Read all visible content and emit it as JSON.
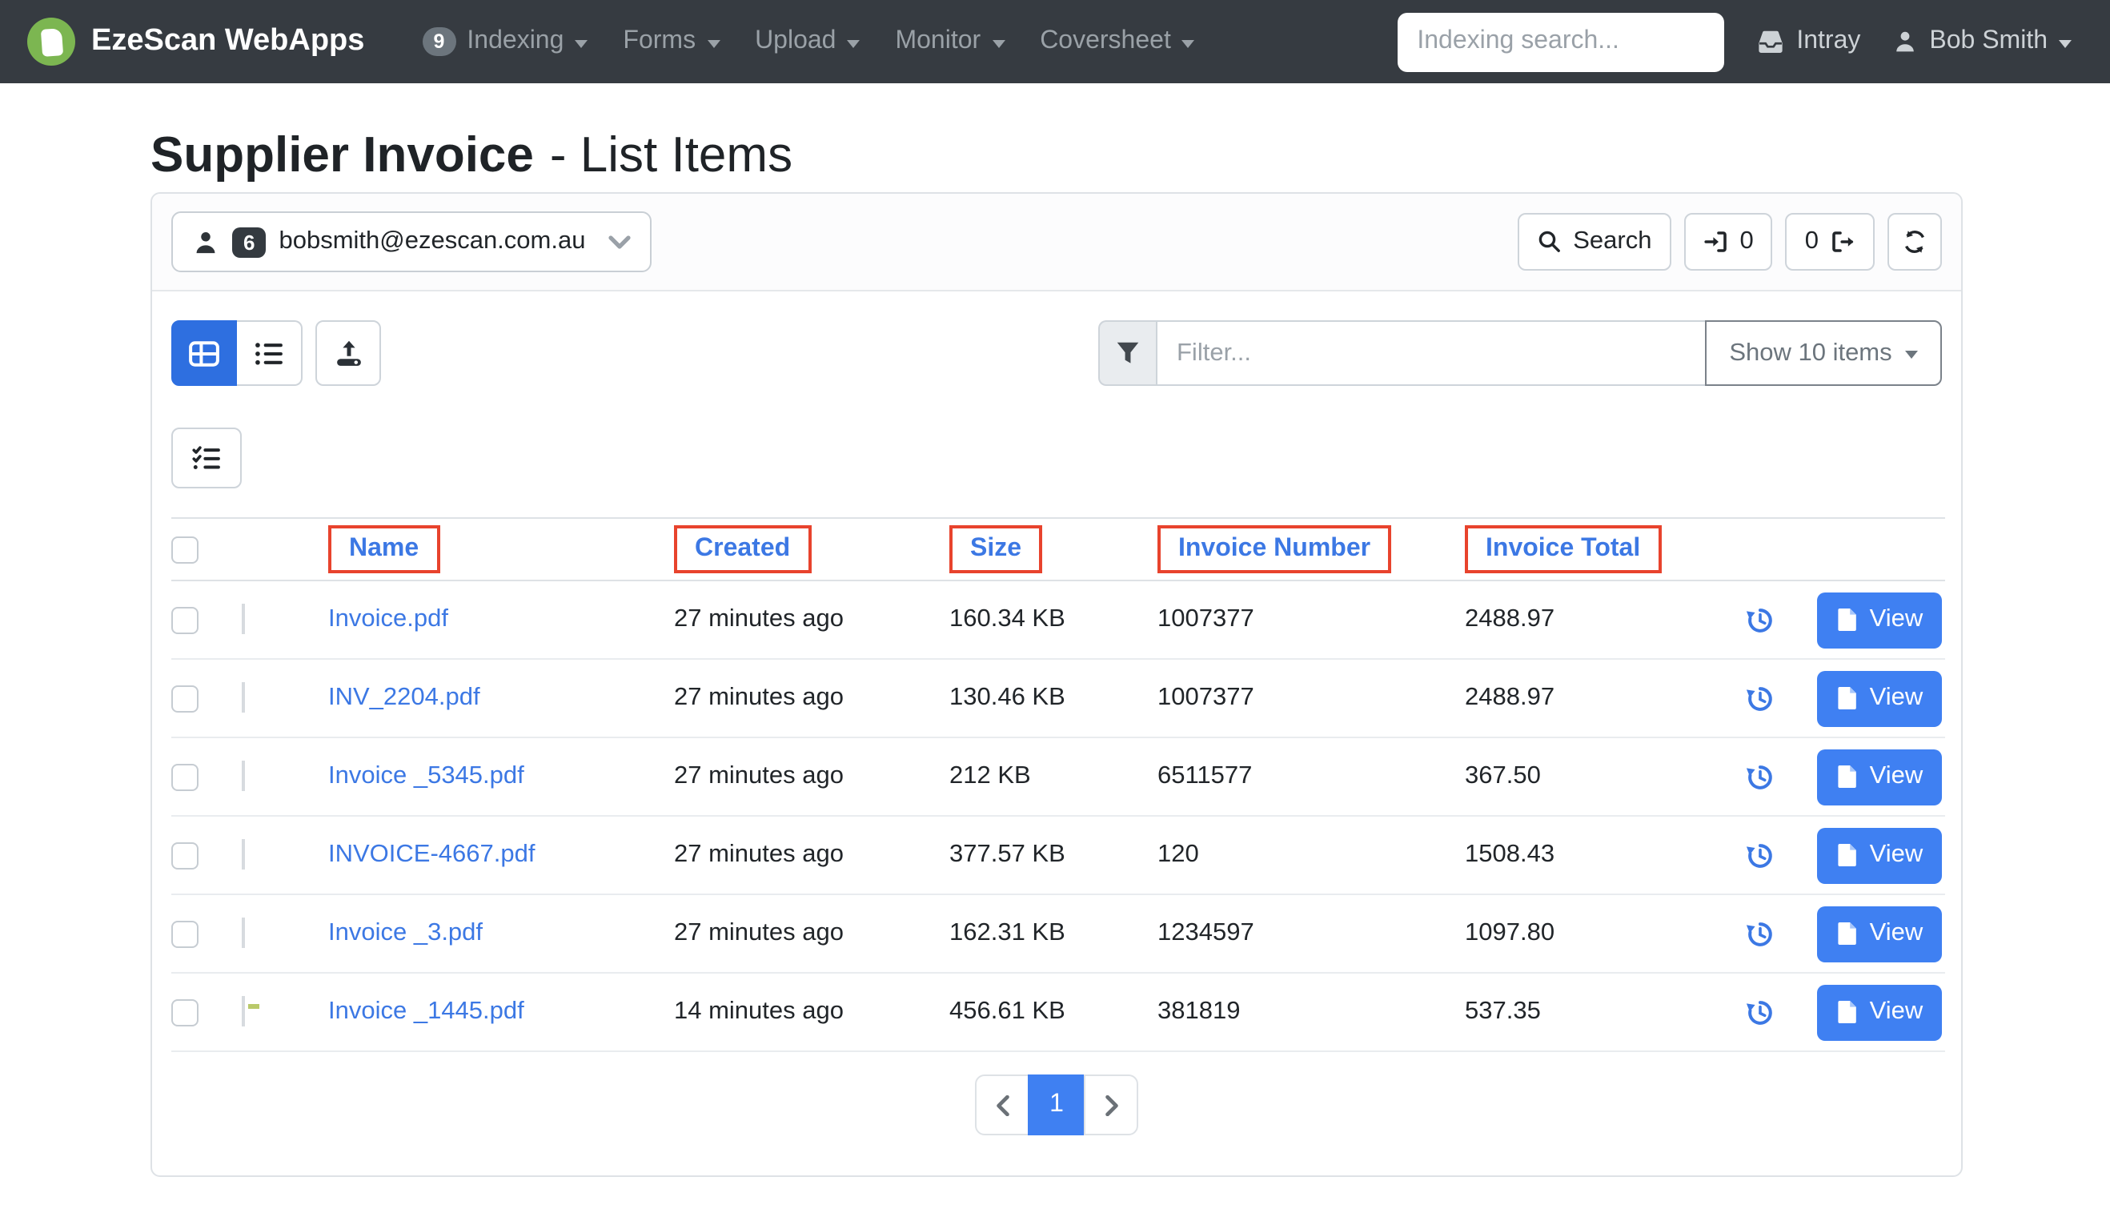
{
  "navbar": {
    "brand": "EzeScan WebApps",
    "indexing_badge": "9",
    "items": [
      {
        "label": "Indexing"
      },
      {
        "label": "Forms"
      },
      {
        "label": "Upload"
      },
      {
        "label": "Monitor"
      },
      {
        "label": "Coversheet"
      }
    ],
    "search_placeholder": "Indexing search...",
    "intray_label": "Intray",
    "user_label": "Bob Smith"
  },
  "page": {
    "title": "Supplier Invoice",
    "subtitle": "- List Items"
  },
  "queue_bar": {
    "user_badge": "6",
    "user_email": "bobsmith@ezescan.com.au",
    "search_label": "Search",
    "checkin_count": "0",
    "checkout_count": "0"
  },
  "toolbar": {
    "filter_placeholder": "Filter...",
    "show_items_label": "Show 10 items"
  },
  "table": {
    "columns": [
      {
        "label": "Name"
      },
      {
        "label": "Created"
      },
      {
        "label": "Size"
      },
      {
        "label": "Invoice Number"
      },
      {
        "label": "Invoice Total"
      }
    ],
    "view_button_label": "View",
    "rows": [
      {
        "name": "Invoice.pdf",
        "created": "27 minutes ago",
        "size": "160.34 KB",
        "invoice_number": "1007377",
        "invoice_total": "2488.97"
      },
      {
        "name": "INV_2204.pdf",
        "created": "27 minutes ago",
        "size": "130.46 KB",
        "invoice_number": "1007377",
        "invoice_total": "2488.97"
      },
      {
        "name": "Invoice _5345.pdf",
        "created": "27 minutes ago",
        "size": "212 KB",
        "invoice_number": "6511577",
        "invoice_total": "367.50"
      },
      {
        "name": "INVOICE-4667.pdf",
        "created": "27 minutes ago",
        "size": "377.57 KB",
        "invoice_number": "120",
        "invoice_total": "1508.43"
      },
      {
        "name": "Invoice _3.pdf",
        "created": "27 minutes ago",
        "size": "162.31 KB",
        "invoice_number": "1234597",
        "invoice_total": "1097.80"
      },
      {
        "name": "Invoice _1445.pdf",
        "created": "14 minutes ago",
        "size": "456.61 KB",
        "invoice_number": "381819",
        "invoice_total": "537.35"
      }
    ]
  },
  "pagination": {
    "page": "1"
  },
  "colors": {
    "navbar_bg": "#363b41",
    "brand_green": "#7cb651",
    "link_blue": "#3c78e4",
    "button_blue": "#3f80f2",
    "toggle_active_blue": "#2e6fe0",
    "annotation_red": "#e8432d"
  }
}
